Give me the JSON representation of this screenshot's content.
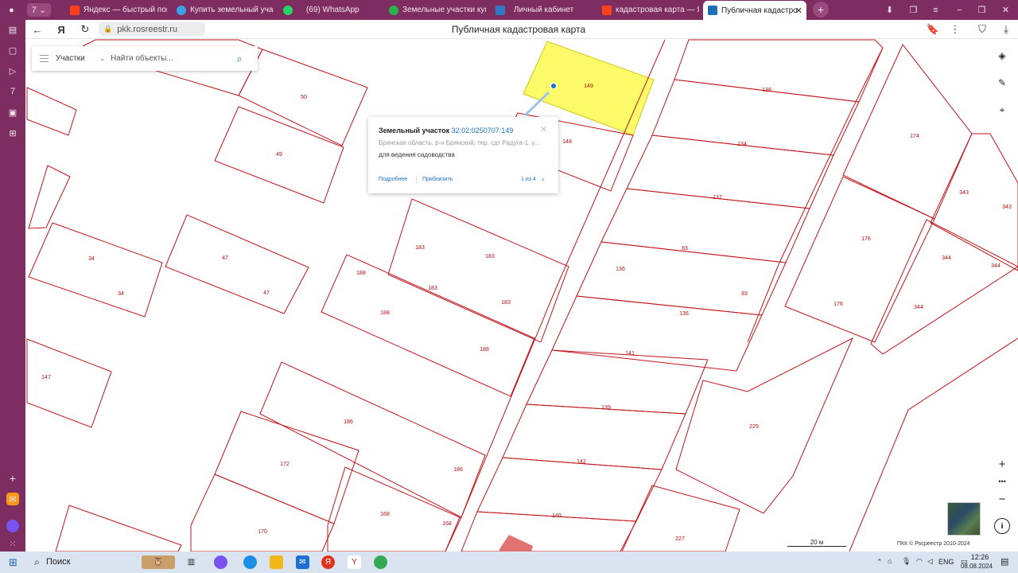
{
  "browser": {
    "tabs": [
      {
        "label": "Яндекс — быстрый поиск",
        "icon": "yandex-icon",
        "color": "#fc3f1d"
      },
      {
        "label": "Купить земельный участок",
        "icon": "avito-icon",
        "color": "#3ca2e5"
      },
      {
        "label": "(69) WhatsApp",
        "icon": "whatsapp-icon",
        "color": "#25d366"
      },
      {
        "label": "Земельные участки купить",
        "icon": "check-icon",
        "color": "#2bb34b"
      },
      {
        "label": "Личный кабинет",
        "icon": "shield-icon",
        "color": "#2f79c6"
      },
      {
        "label": "кадастровая карта — Яндекс",
        "icon": "yandex-icon",
        "color": "#fc3f1d"
      },
      {
        "label": "Публичная кадастровая",
        "icon": "rosreestr-icon",
        "color": "#1f6fb7"
      }
    ],
    "tab_counter": "7",
    "url": "pkk.rosreestr.ru",
    "page_title": "Публичная кадастровая карта"
  },
  "search": {
    "type": "Участки",
    "placeholder": "Найти объекты..."
  },
  "popup": {
    "title": "Земельный участок",
    "cadastral_number": "32:02:0250707:149",
    "address": "Брянская область, р-н Брянский, тер. сдт Радуга-1, у...",
    "purpose": "для ведения садоводства",
    "more_link": "Подробнее",
    "zoom_link": "Приблизить",
    "pager": "1 из 4"
  },
  "map": {
    "colors": {
      "boundary": "#c0141b",
      "selected_fill": "#fbfb6a",
      "selected_stroke": "#d4c21c",
      "marker": "#1a6fd6",
      "highlight": "#e07272"
    },
    "parcel_labels": [
      "149",
      "148",
      "138",
      "134",
      "137",
      "83",
      "136",
      "141",
      "139",
      "142",
      "140",
      "227",
      "225",
      "176",
      "174",
      "343",
      "344",
      "50",
      "49",
      "34",
      "47",
      "183",
      "188",
      "147",
      "186",
      "172",
      "170",
      "168"
    ],
    "scale": "20 м",
    "copyright": "ПКК © Росреестр 2010-2024"
  },
  "taskbar": {
    "search_label": "Поиск",
    "language": "ENG",
    "time": "12:26",
    "date": "08.08.2024"
  }
}
